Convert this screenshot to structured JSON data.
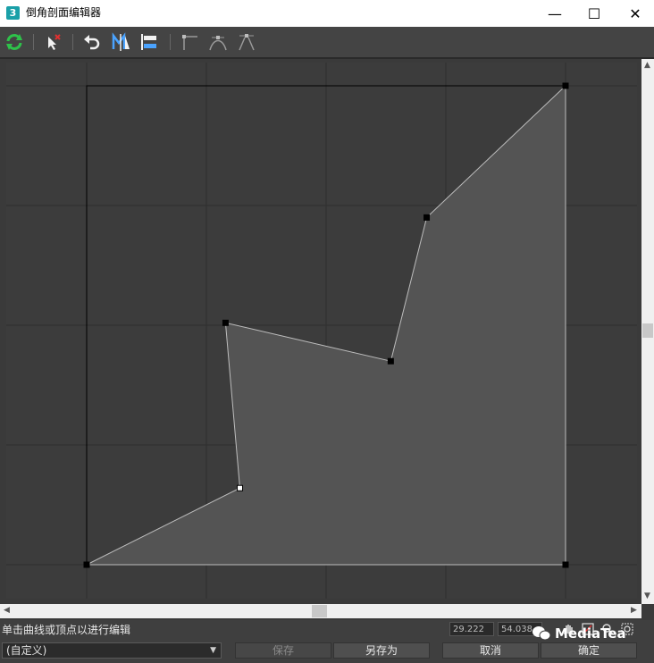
{
  "window": {
    "title": "倒角剖面编辑器",
    "app_icon_text": "3",
    "minimize": "—",
    "maximize": "☐",
    "close": "✕"
  },
  "toolbar": {
    "items": [
      {
        "name": "refresh-icon"
      },
      {
        "name": "delete-point-icon"
      },
      {
        "name": "undo-icon"
      },
      {
        "name": "mirror-icon"
      },
      {
        "name": "align-icon"
      },
      {
        "name": "corner-point-icon"
      },
      {
        "name": "bezier-smooth-icon"
      },
      {
        "name": "bezier-corner-icon"
      }
    ]
  },
  "curve": {
    "points": [
      [
        0,
        0
      ],
      [
        100,
        0
      ],
      [
        100,
        100
      ],
      [
        71,
        72.5
      ],
      [
        63.5,
        42.5
      ],
      [
        29,
        50.5
      ],
      [
        32,
        16
      ],
      [
        0,
        0
      ]
    ],
    "fill_color": "#545454",
    "stroke_color": "#bdbdbd"
  },
  "status": {
    "message": "单击曲线或顶点以进行编辑",
    "coord_x": "29.222",
    "coord_y": "54.038"
  },
  "bottom": {
    "preset_value": "(自定义)",
    "save_label": "保存",
    "save_as_label": "另存为",
    "cancel_label": "取消",
    "ok_label": "确定"
  },
  "watermark": {
    "text": "MediaTea"
  }
}
